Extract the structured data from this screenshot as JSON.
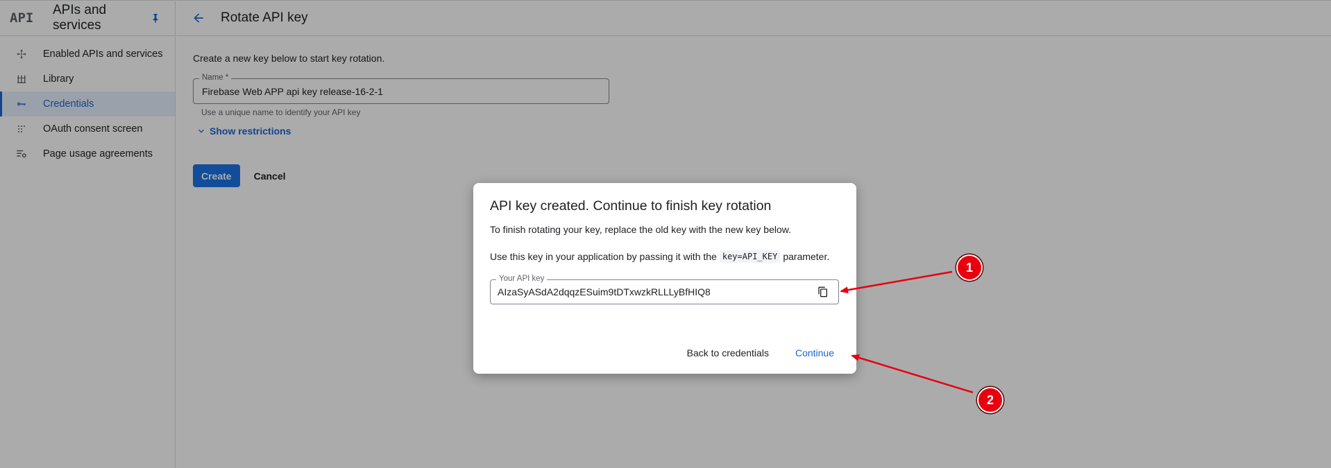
{
  "sidebar": {
    "logo": "API",
    "title": "APIs and services",
    "items": [
      {
        "label": "Enabled APIs and services",
        "icon": "diamond-arrows-icon"
      },
      {
        "label": "Library",
        "icon": "library-icon"
      },
      {
        "label": "Credentials",
        "icon": "key-icon",
        "active": true
      },
      {
        "label": "OAuth consent screen",
        "icon": "dots-grid-icon"
      },
      {
        "label": "Page usage agreements",
        "icon": "list-settings-icon"
      }
    ]
  },
  "header": {
    "title": "Rotate API key"
  },
  "form": {
    "intro": "Create a new key below to start key rotation.",
    "name_label": "Name *",
    "name_value": "Firebase Web APP api key release-16-2-1",
    "name_hint": "Use a unique name to identify your API key",
    "show_restrictions": "Show restrictions",
    "create_label": "Create",
    "cancel_label": "Cancel"
  },
  "dialog": {
    "title": "API key created. Continue to finish key rotation",
    "p1": "To finish rotating your key, replace the old key with the new key below.",
    "p2_before": "Use this key in your application by passing it with the",
    "p2_code": "key=API_KEY",
    "p2_after": "parameter.",
    "key_label": "Your API key",
    "key_value": "AIzaSyASdA2dqqzESuim9tDTxwzkRLLLyBfHIQ8",
    "back_label": "Back to credentials",
    "continue_label": "Continue"
  },
  "annotations": {
    "badge1": "1",
    "badge2": "2",
    "arrow_color": "#e8000f"
  },
  "colors": {
    "accent": "#1a73e8",
    "link": "#1967d2"
  }
}
